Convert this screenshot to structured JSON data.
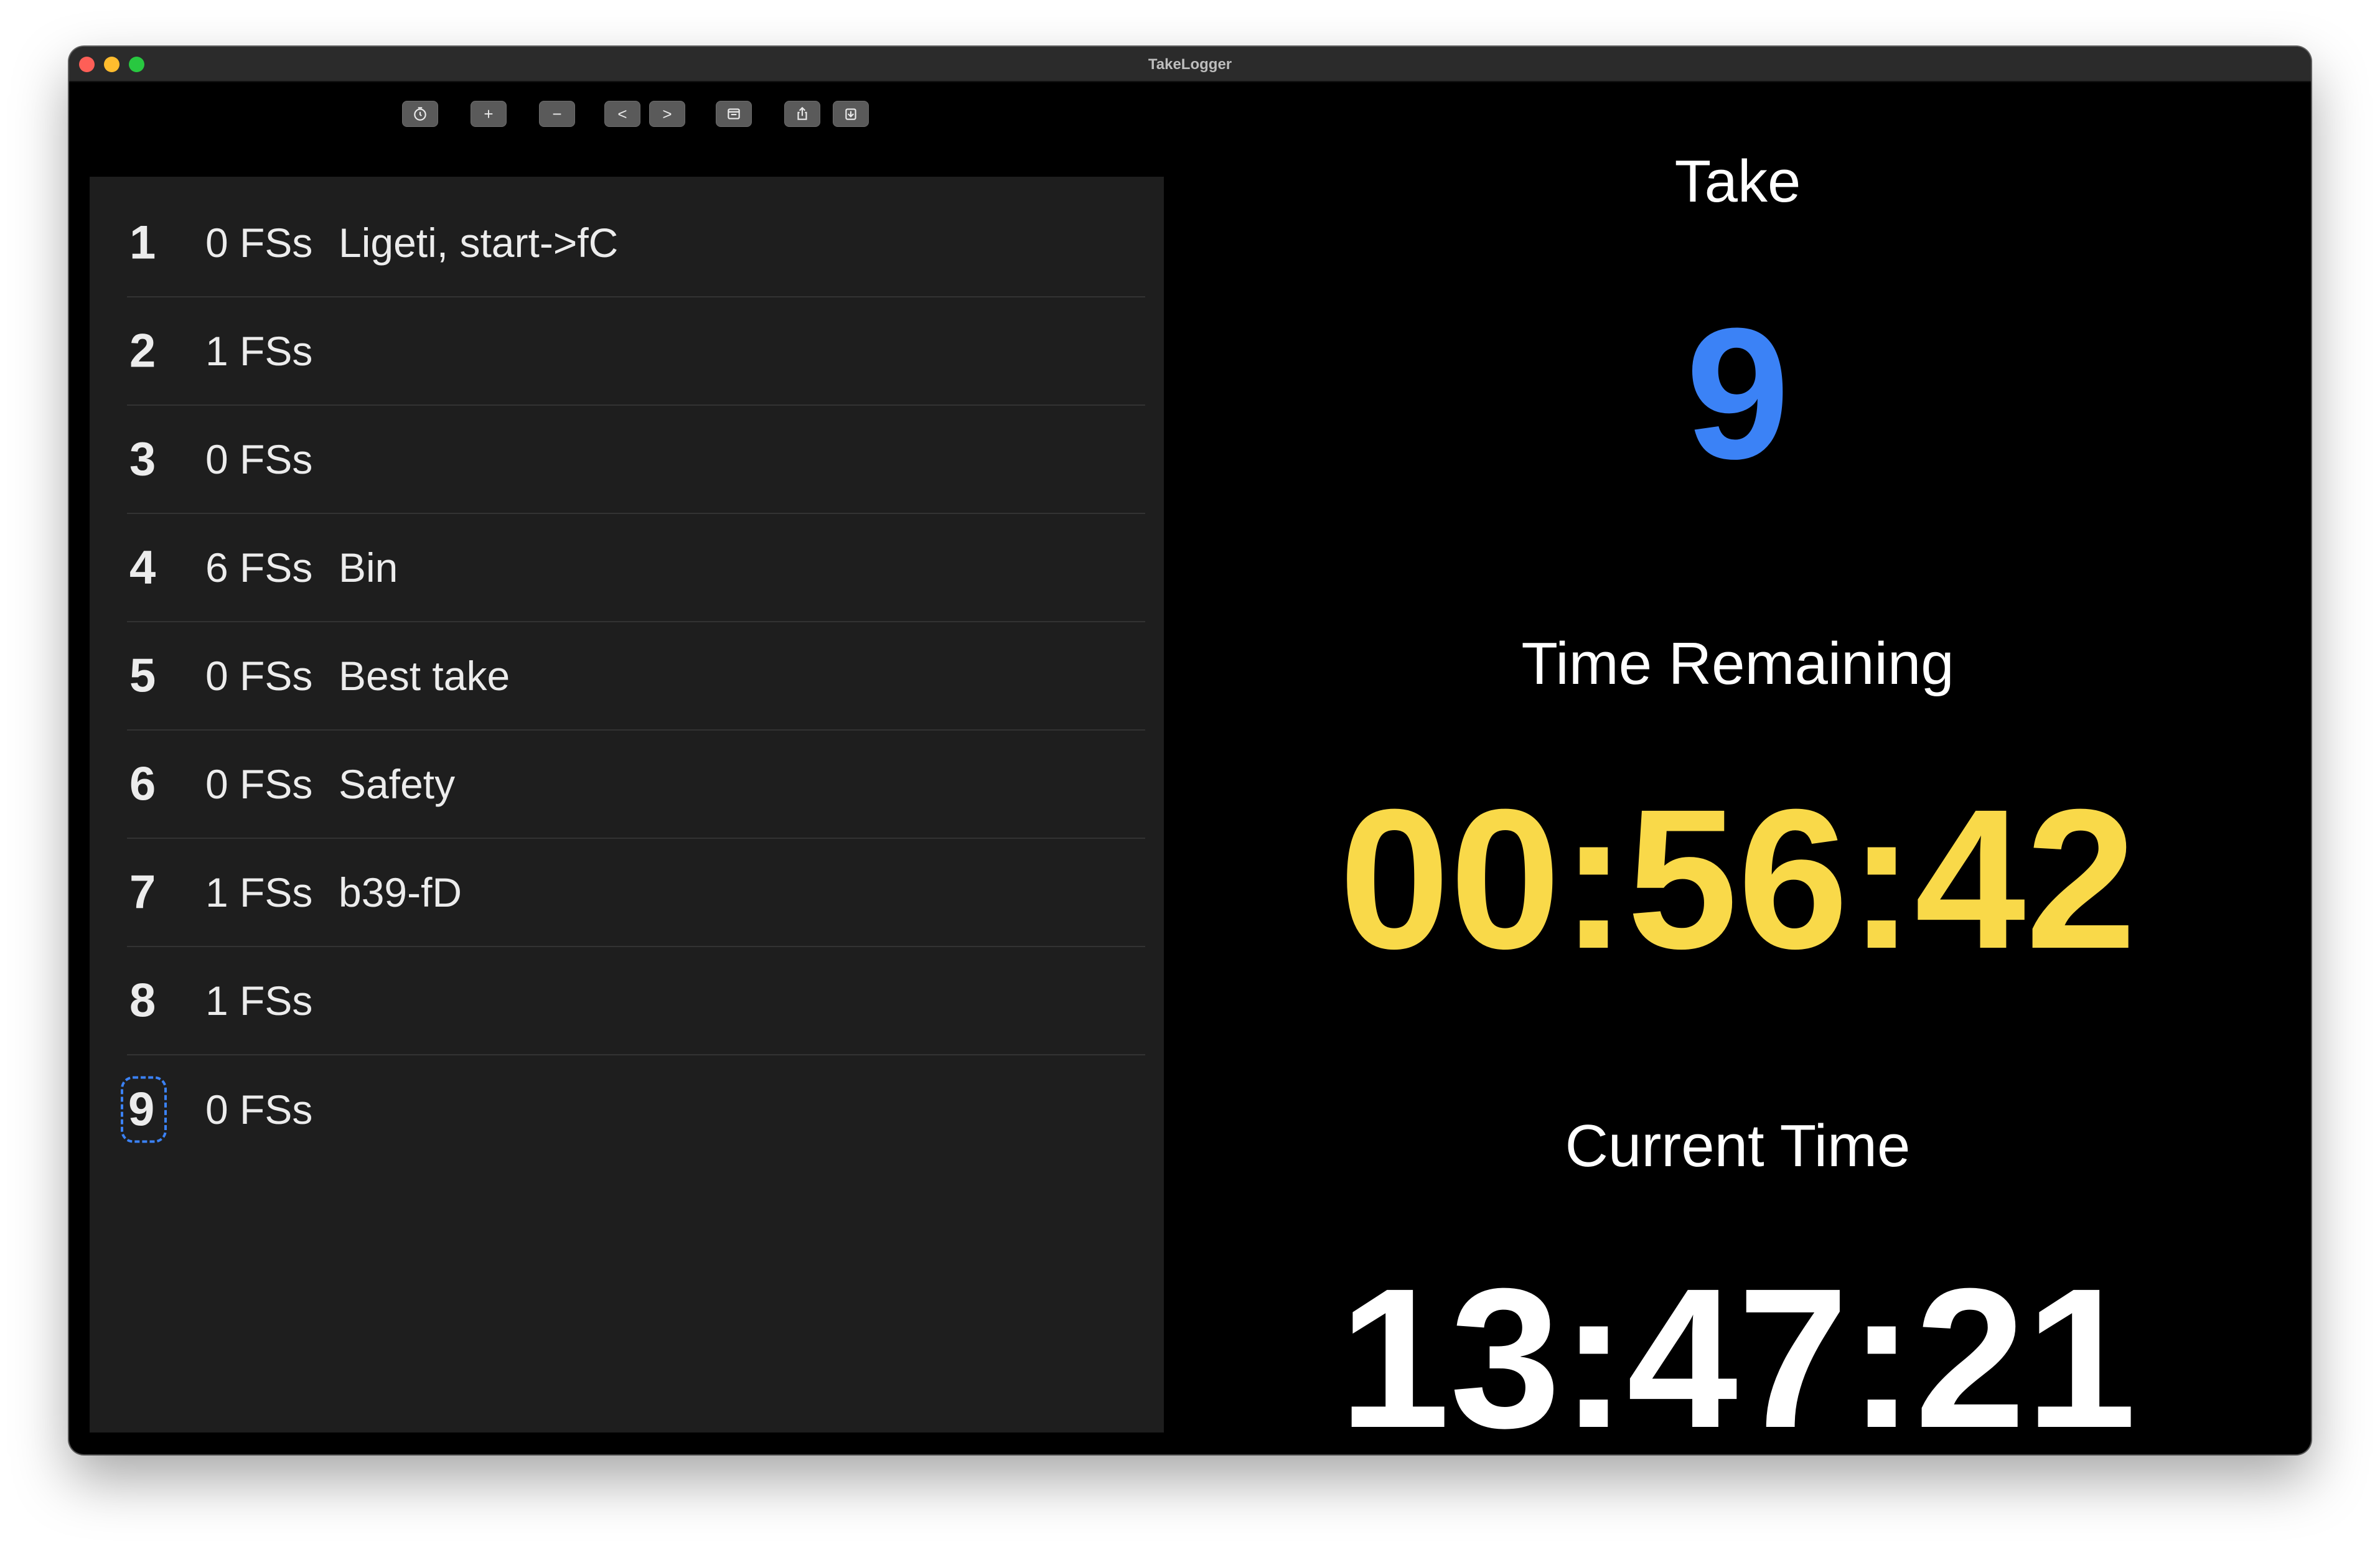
{
  "window": {
    "title": "TakeLogger"
  },
  "toolbar": {
    "buttons": [
      {
        "name": "timer-button",
        "icon": "timer-icon",
        "glyph": "⏲"
      },
      {
        "name": "add-take-button",
        "icon": "plus-icon",
        "glyph": "+"
      },
      {
        "name": "remove-take-button",
        "icon": "minus-icon",
        "glyph": "−"
      },
      {
        "name": "previous-button",
        "icon": "chevron-left-icon",
        "glyph": "<"
      },
      {
        "name": "next-button",
        "icon": "chevron-right-icon",
        "glyph": ">"
      },
      {
        "name": "window-button",
        "icon": "window-icon",
        "glyph": "▭"
      },
      {
        "name": "export-button",
        "icon": "share-icon",
        "glyph": "⇧"
      },
      {
        "name": "import-button",
        "icon": "import-icon",
        "glyph": "⇩"
      }
    ]
  },
  "takes": [
    {
      "number": "1",
      "fss": "0 FSs",
      "note": "Ligeti, start->fC"
    },
    {
      "number": "2",
      "fss": "1 FSs",
      "note": ""
    },
    {
      "number": "3",
      "fss": "0 FSs",
      "note": ""
    },
    {
      "number": "4",
      "fss": "6 FSs",
      "note": "Bin"
    },
    {
      "number": "5",
      "fss": "0 FSs",
      "note": "Best take"
    },
    {
      "number": "6",
      "fss": "0 FSs",
      "note": "Safety"
    },
    {
      "number": "7",
      "fss": "1 FSs",
      "note": "b39-fD"
    },
    {
      "number": "8",
      "fss": "1 FSs",
      "note": ""
    },
    {
      "number": "9",
      "fss": "0 FSs",
      "note": ""
    }
  ],
  "selected_take": "9",
  "display": {
    "take_label": "Take",
    "take_value": "9",
    "remaining_label": "Time Remaining",
    "remaining_value": "00:56:42",
    "current_label": "Current Time",
    "current_value": "13:47:21"
  },
  "colors": {
    "take_value": "#3b82f6",
    "remaining_value": "#f9d949",
    "current_value": "#ffffff",
    "list_background": "#1e1e1e",
    "window_background": "#000000"
  }
}
